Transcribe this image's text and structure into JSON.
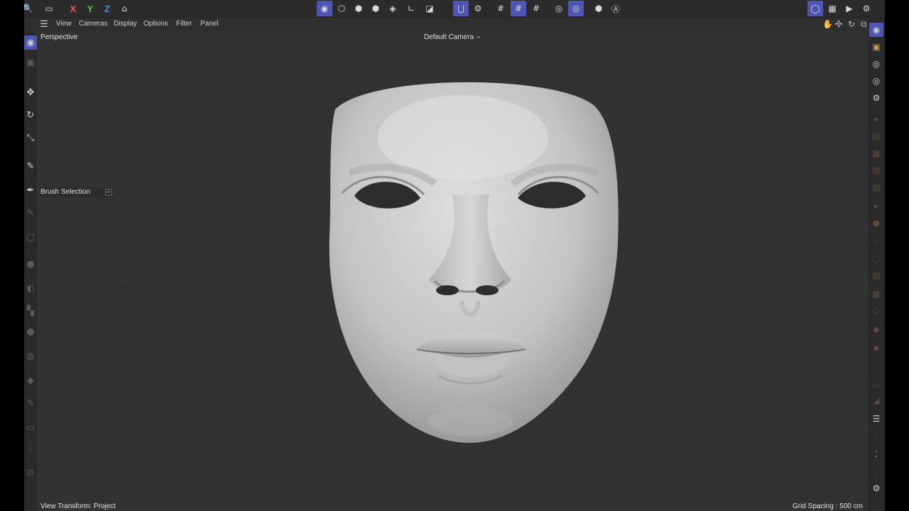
{
  "toolbar": {
    "axis_x": "X",
    "axis_y": "Y",
    "axis_z": "Z",
    "icons": [
      "search-icon",
      "undo-icon",
      "coordinate-system-icon",
      "model-mode-icon",
      "object-mode-icon",
      "points-mode-icon",
      "edges-mode-icon",
      "polygons-mode-icon",
      "uv-mode-icon",
      "workplane-icon",
      "snap-icon",
      "snap-settings-icon",
      "grid-icon",
      "quantize-icon",
      "workplane-grid-icon",
      "solo-icon",
      "solo-hierarchy-icon",
      "render-icon",
      "render-view-icon",
      "render-settings-icon",
      "picture-viewer-icon"
    ]
  },
  "menubar": {
    "items": [
      "View",
      "Cameras",
      "Display",
      "Options",
      "Filter",
      "Panel"
    ]
  },
  "viewport": {
    "view_name": "Perspective",
    "camera_name": "Default Camera",
    "camera_marker": "▫•",
    "tool_name": "Brush Selection",
    "view_transform": "View Transform: Project",
    "grid_spacing": "Grid Spacing : 500 cm"
  },
  "colors": {
    "accent": "#4f55b3",
    "axis_x": "#e0604a",
    "axis_y": "#5fc04a",
    "axis_z": "#4a8ae0",
    "viewport_bg": "#323232",
    "mask": "#c8c8c8"
  }
}
